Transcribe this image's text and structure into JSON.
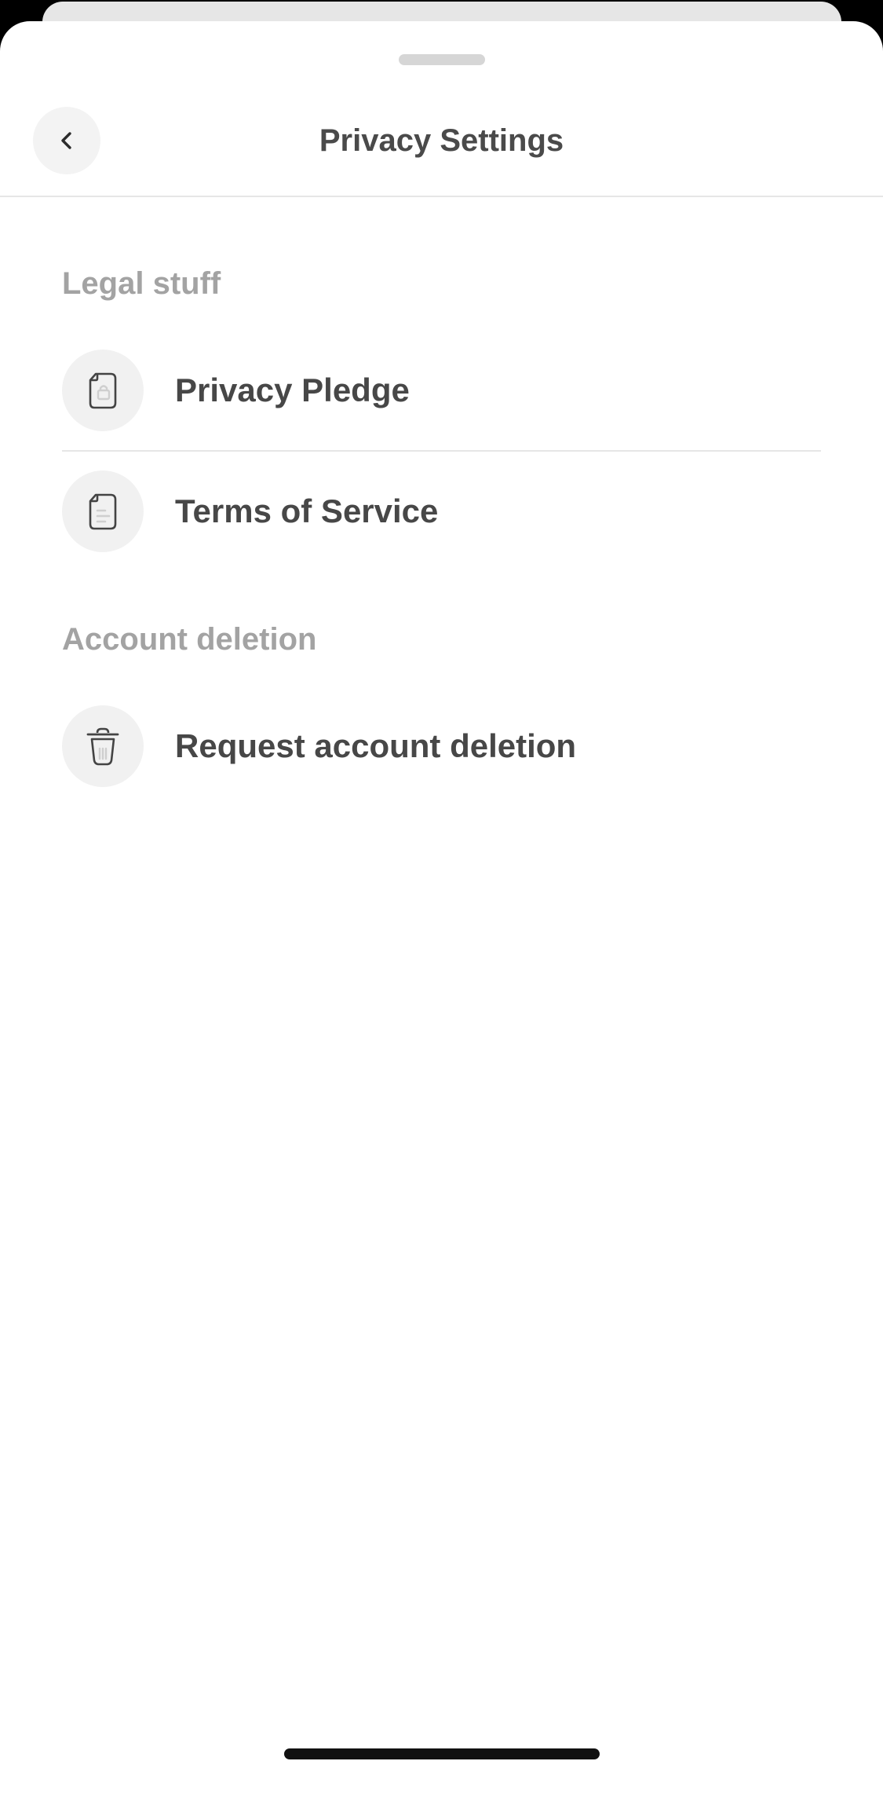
{
  "header": {
    "title": "Privacy Settings",
    "back_icon": "chevron-left-icon"
  },
  "sections": [
    {
      "title": "Legal stuff",
      "items": [
        {
          "label": "Privacy Pledge",
          "icon": "document-lock-icon"
        },
        {
          "label": "Terms of Service",
          "icon": "document-text-icon"
        }
      ]
    },
    {
      "title": "Account deletion",
      "items": [
        {
          "label": "Request account deletion",
          "icon": "trash-icon"
        }
      ]
    }
  ],
  "colors": {
    "title_text": "#4a4a4a",
    "section_header_text": "#a3a3a3",
    "row_label_text": "#474747",
    "icon_circle_bg": "#f1f1f1",
    "divider": "#e6e6e6",
    "sheet_background": "#ffffff"
  }
}
